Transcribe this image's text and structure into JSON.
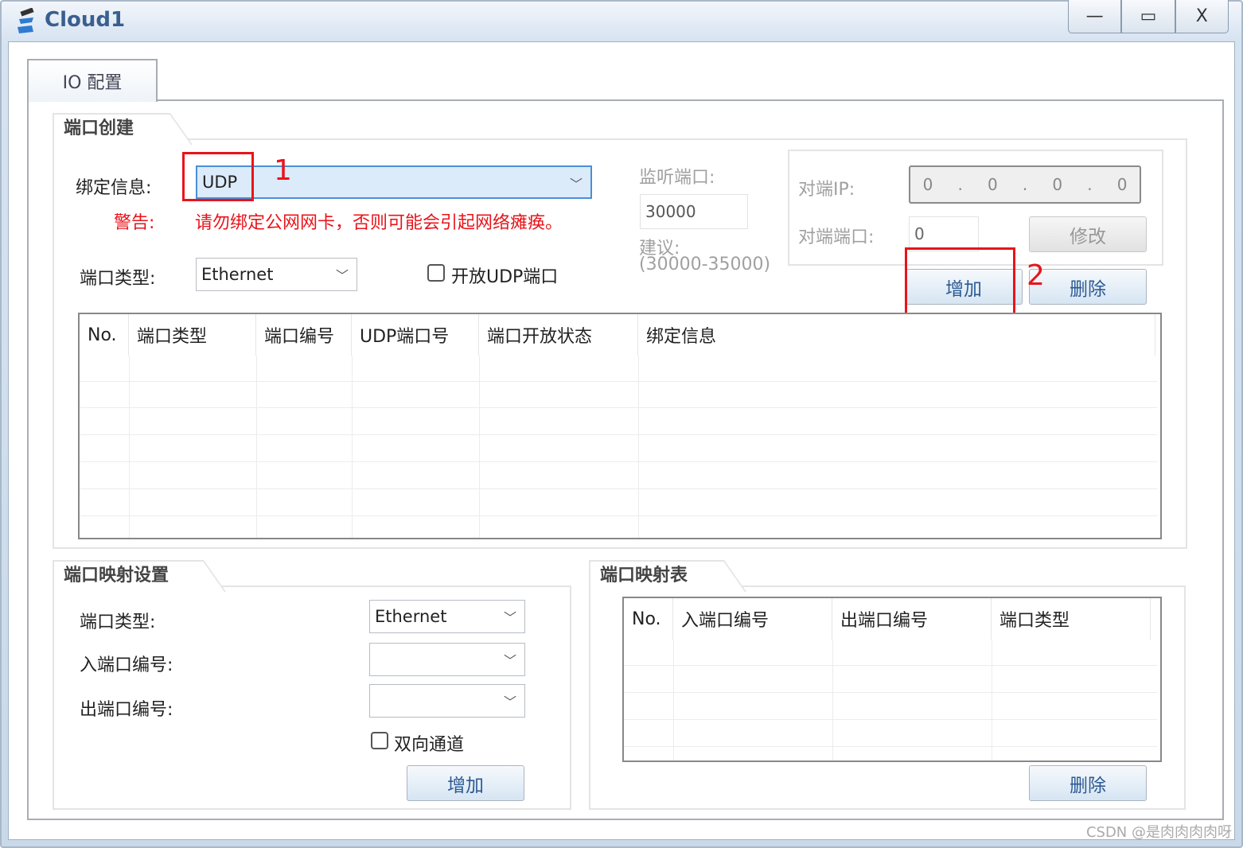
{
  "window": {
    "title": "Cloud1",
    "minimize": "—",
    "maximize": "▭",
    "close": "X"
  },
  "tab": {
    "label": "IO 配置"
  },
  "port_create": {
    "title": "端口创建",
    "bind_label": "绑定信息:",
    "bind_value": "UDP",
    "warning_label": "警告:",
    "warning_text": "请勿绑定公网网卡，否则可能会引起网络瘫痪。",
    "port_type_label": "端口类型:",
    "port_type_value": "Ethernet",
    "open_udp_label": "开放UDP端口",
    "open_udp_checked": false,
    "listen_port_label": "监听端口:",
    "listen_port_value": "30000",
    "suggest_label": "建议:",
    "suggest_range": "(30000-35000)",
    "peer_ip_label": "对端IP:",
    "peer_ip": [
      "0",
      "0",
      "0",
      "0"
    ],
    "peer_port_label": "对端端口:",
    "peer_port_value": "0",
    "modify_button": "修改",
    "add_button": "增加",
    "delete_button": "删除",
    "table_headers": [
      "No.",
      "端口类型",
      "端口编号",
      "UDP端口号",
      "端口开放状态",
      "绑定信息"
    ]
  },
  "port_map_settings": {
    "title": "端口映射设置",
    "port_type_label": "端口类型:",
    "port_type_value": "Ethernet",
    "in_port_label": "入端口编号:",
    "in_port_value": "",
    "out_port_label": "出端口编号:",
    "out_port_value": "",
    "bidirectional_label": "双向通道",
    "bidirectional_checked": false,
    "add_button": "增加"
  },
  "port_map_table": {
    "title": "端口映射表",
    "headers": [
      "No.",
      "入端口编号",
      "出端口编号",
      "端口类型"
    ],
    "delete_button": "删除"
  },
  "annotations": {
    "marker1": "1",
    "marker2": "2",
    "color": "#e8141b"
  },
  "watermark": "CSDN @是肉肉肉肉呀"
}
